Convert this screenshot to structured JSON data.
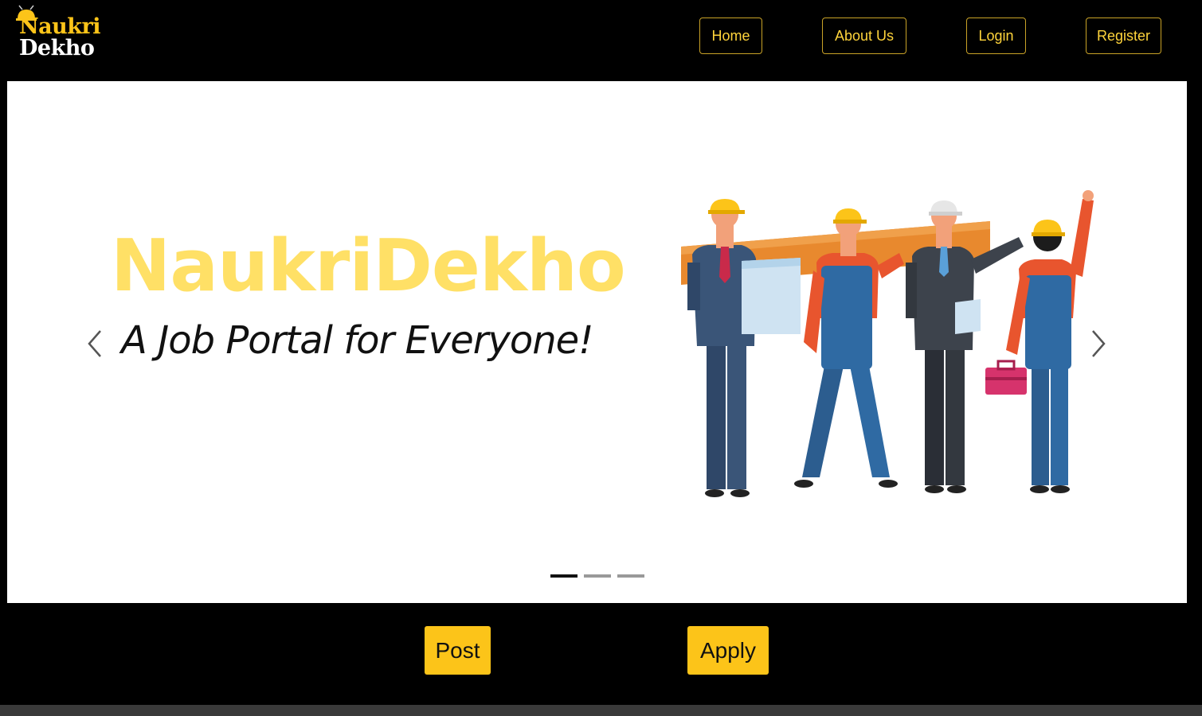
{
  "header": {
    "logo": {
      "line1": "Naukri",
      "line2": "Dekho"
    },
    "nav": [
      {
        "label": "Home"
      },
      {
        "label": "About Us"
      },
      {
        "label": "Login"
      },
      {
        "label": "Register"
      }
    ]
  },
  "carousel": {
    "title": "NaukriDekho",
    "tagline": "A Job Portal for Everyone!",
    "prev_icon": "chevron-left-icon",
    "next_icon": "chevron-right-icon",
    "slide_count": 3,
    "active_slide": 1
  },
  "actions": {
    "post_label": "Post",
    "apply_label": "Apply"
  },
  "colors": {
    "accent": "#fcc419",
    "title_yellow": "#ffe066",
    "background": "#000000"
  }
}
